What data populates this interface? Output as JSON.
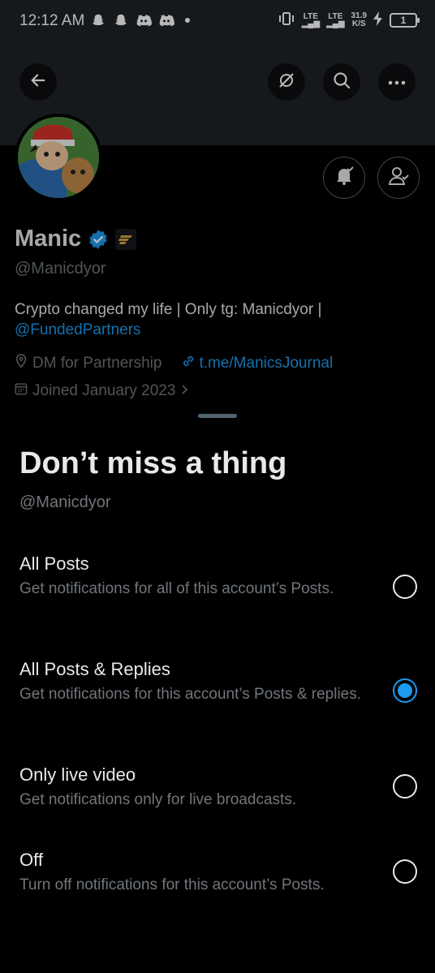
{
  "status_bar": {
    "time": "12:12 AM",
    "network_1": "LTE",
    "network_2": "LTE",
    "speed": "31.9",
    "speed_unit": "K/S",
    "battery": "1"
  },
  "profile": {
    "name": "Manic",
    "handle": "@Manicdyor",
    "bio_text": "Crypto changed my life | Only tg: Manicdyor | ",
    "bio_mention": "@FundedPartners",
    "location": "DM for Partnership",
    "website": "t.me/ManicsJournal",
    "joined": "Joined January 2023"
  },
  "sheet": {
    "title": "Don’t miss a thing",
    "handle": "@Manicdyor",
    "options": [
      {
        "title": "All Posts",
        "desc": "Get notifications for all of this account’s Posts.",
        "selected": false
      },
      {
        "title": "All Posts & Replies",
        "desc": "Get notifications for this account’s Posts & replies.",
        "selected": true
      },
      {
        "title": "Only live video",
        "desc": "Get notifications only for live broadcasts.",
        "selected": false
      },
      {
        "title": "Off",
        "desc": "Turn off notifications for this account’s Posts.",
        "selected": false
      }
    ]
  },
  "colors": {
    "accent": "#1d9bf0",
    "background": "#000000",
    "muted_text": "#71767b",
    "banner": "#1f2327"
  }
}
